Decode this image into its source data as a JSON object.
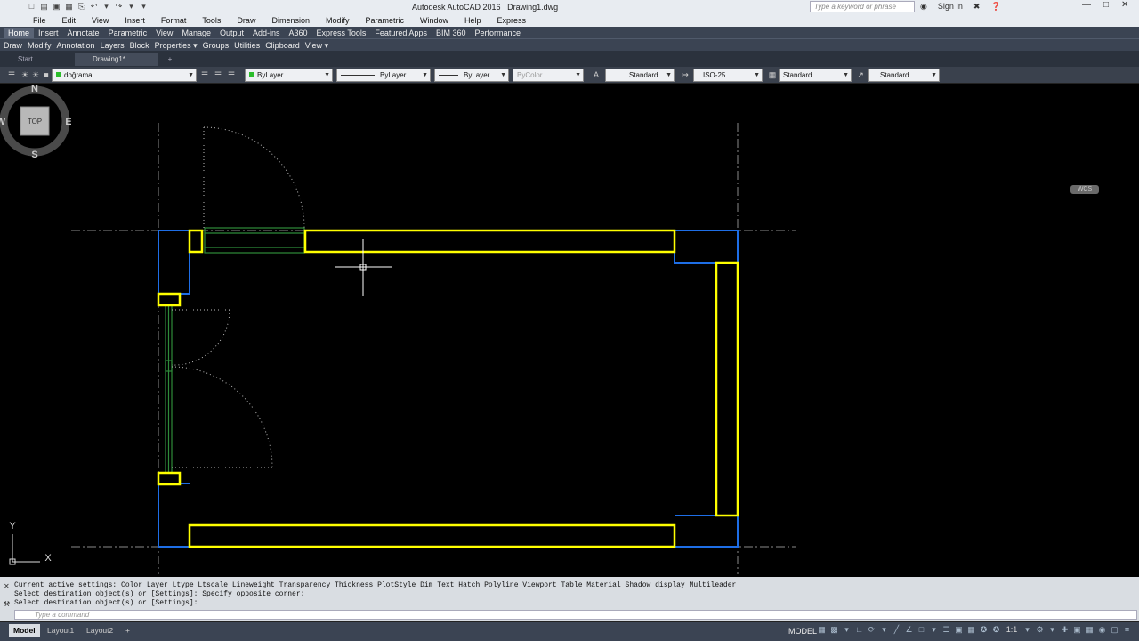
{
  "app": {
    "title": "Autodesk AutoCAD 2016",
    "filename": "Drawing1.dwg",
    "logo": "A"
  },
  "search": {
    "placeholder": "Type a keyword or phrase"
  },
  "header": {
    "signin": "Sign In"
  },
  "menu": [
    "File",
    "Edit",
    "View",
    "Insert",
    "Format",
    "Tools",
    "Draw",
    "Dimension",
    "Modify",
    "Parametric",
    "Window",
    "Help",
    "Express"
  ],
  "ribbon_tabs": [
    "Home",
    "Insert",
    "Annotate",
    "Parametric",
    "View",
    "Manage",
    "Output",
    "Add-ins",
    "A360",
    "Express Tools",
    "Featured Apps",
    "BIM 360",
    "Performance"
  ],
  "panels": [
    "Draw",
    "Modify",
    "Annotation",
    "Layers",
    "Block",
    "Properties ▾",
    "Groups",
    "Utilities",
    "Clipboard",
    "View ▾"
  ],
  "file_tabs": [
    "Start",
    "Drawing1*"
  ],
  "toolbar": {
    "layer": "doğrama",
    "color": "ByLayer",
    "linetype": "ByLayer",
    "lineweight": "ByLayer",
    "plotstyle": "ByColor",
    "text_style": "Standard",
    "dim_style": "ISO-25",
    "table_style": "Standard",
    "mleader_style": "Standard"
  },
  "viewcube": {
    "n": "N",
    "s": "S",
    "e": "E",
    "w": "W",
    "face": "TOP",
    "wcs": "WCS"
  },
  "ucs": {
    "x": "X",
    "y": "Y"
  },
  "command": {
    "history": [
      "Current active settings:  Color Layer Ltype Ltscale Lineweight Transparency Thickness PlotStyle Dim Text Hatch Polyline Viewport Table Material Shadow display Multileader",
      "Select destination object(s) or [Settings]: Specify opposite corner:",
      "Select destination object(s) or [Settings]:"
    ],
    "placeholder": "Type a command"
  },
  "layout_tabs": [
    "Model",
    "Layout1",
    "Layout2"
  ],
  "status": {
    "space": "MODEL",
    "scale": "1:1"
  },
  "colors": {
    "wall_yellow": "#ffff00",
    "wall_blue": "#1e6ee6",
    "door_green": "#2e8b3a",
    "canvas": "#000000"
  }
}
